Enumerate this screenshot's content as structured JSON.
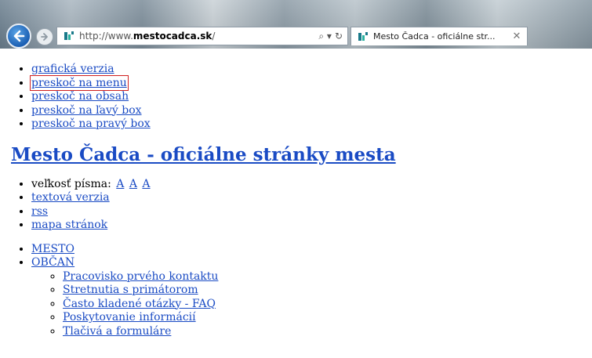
{
  "browser": {
    "url_prefix": "http://www.",
    "url_domain": "mestocadca.sk",
    "url_suffix": "/",
    "search_glyph": "⌕ ▾",
    "refresh_glyph": "↻",
    "tab_title": "Mesto Čadca - oficiálne str...",
    "tab_close": "✕",
    "icons": [
      "back-arrow-icon",
      "forward-arrow-icon",
      "site-favicon-icon",
      "search-icon",
      "refresh-icon",
      "close-icon"
    ]
  },
  "skip_links": [
    "grafická verzia",
    "preskoč na menu",
    "preskoč na obsah",
    "preskoč na ľavý box",
    "preskoč na pravý box"
  ],
  "site_title": "Mesto Čadca - oficiálne stránky mesta",
  "tools": {
    "font_size_label": "veľkosť písma:",
    "font_size_options": [
      "A",
      "A",
      "A"
    ],
    "links": [
      "textová verzia",
      "rss",
      "mapa stránok"
    ]
  },
  "menu": {
    "items": [
      "MESTO",
      "OBČAN"
    ],
    "obcan_subitems": [
      "Pracovisko prvého kontaktu",
      "Stretnutia s primátorom",
      "Často kladené otázky - FAQ",
      "Poskytovanie informácií",
      "Tlačivá a formuláre"
    ]
  },
  "colors": {
    "link": "#1a4bc4",
    "focus_outline": "#d02020",
    "back_button": "#1b5fb3"
  }
}
